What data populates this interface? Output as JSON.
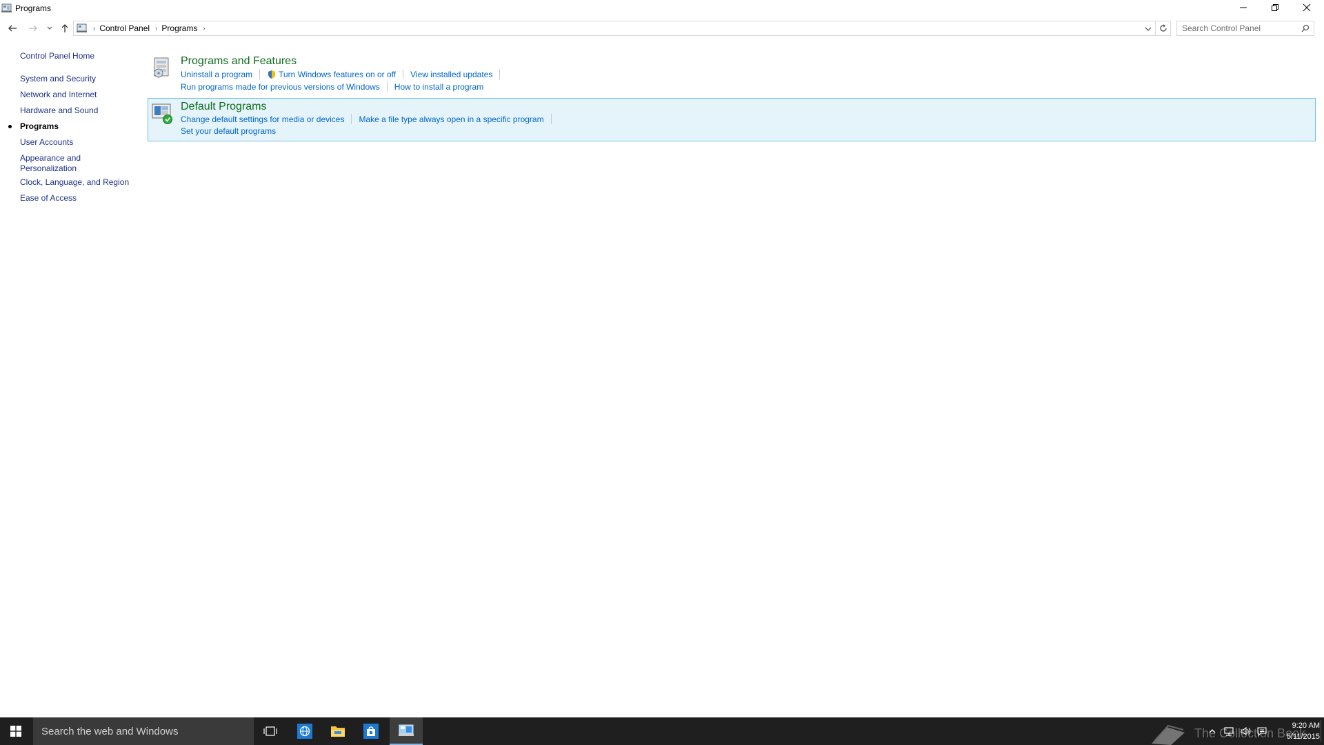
{
  "window": {
    "title": "Programs"
  },
  "breadcrumb": {
    "items": [
      "Control Panel",
      "Programs"
    ]
  },
  "search": {
    "placeholder": "Search Control Panel"
  },
  "sidebar": {
    "home": "Control Panel Home",
    "items": [
      {
        "label": "System and Security",
        "current": false
      },
      {
        "label": "Network and Internet",
        "current": false
      },
      {
        "label": "Hardware and Sound",
        "current": false
      },
      {
        "label": "Programs",
        "current": true
      },
      {
        "label": "User Accounts",
        "current": false
      },
      {
        "label": "Appearance and Personalization",
        "current": false
      },
      {
        "label": "Clock, Language, and Region",
        "current": false
      },
      {
        "label": "Ease of Access",
        "current": false
      }
    ]
  },
  "categories": [
    {
      "title": "Programs and Features",
      "links_row1": [
        "Uninstall a program",
        "Turn Windows features on or off",
        "View installed updates"
      ],
      "links_row2": [
        "Run programs made for previous versions of Windows",
        "How to install a program"
      ]
    },
    {
      "title": "Default Programs",
      "links_row1": [
        "Change default settings for media or devices",
        "Make a file type always open in a specific program"
      ],
      "links_row2": [
        "Set your default programs"
      ]
    }
  ],
  "taskbar": {
    "search_placeholder": "Search the web and Windows",
    "watermark": "The Collection Book",
    "time": "9:20 AM",
    "date": "5/11/2015"
  },
  "colors": {
    "link": "#0066cc",
    "category_title": "#0d6c1d",
    "nav_link": "#1e3287",
    "highlight_bg": "#e5f3fb",
    "highlight_border": "#70c0e7",
    "taskbar": "#1f1f1f"
  }
}
